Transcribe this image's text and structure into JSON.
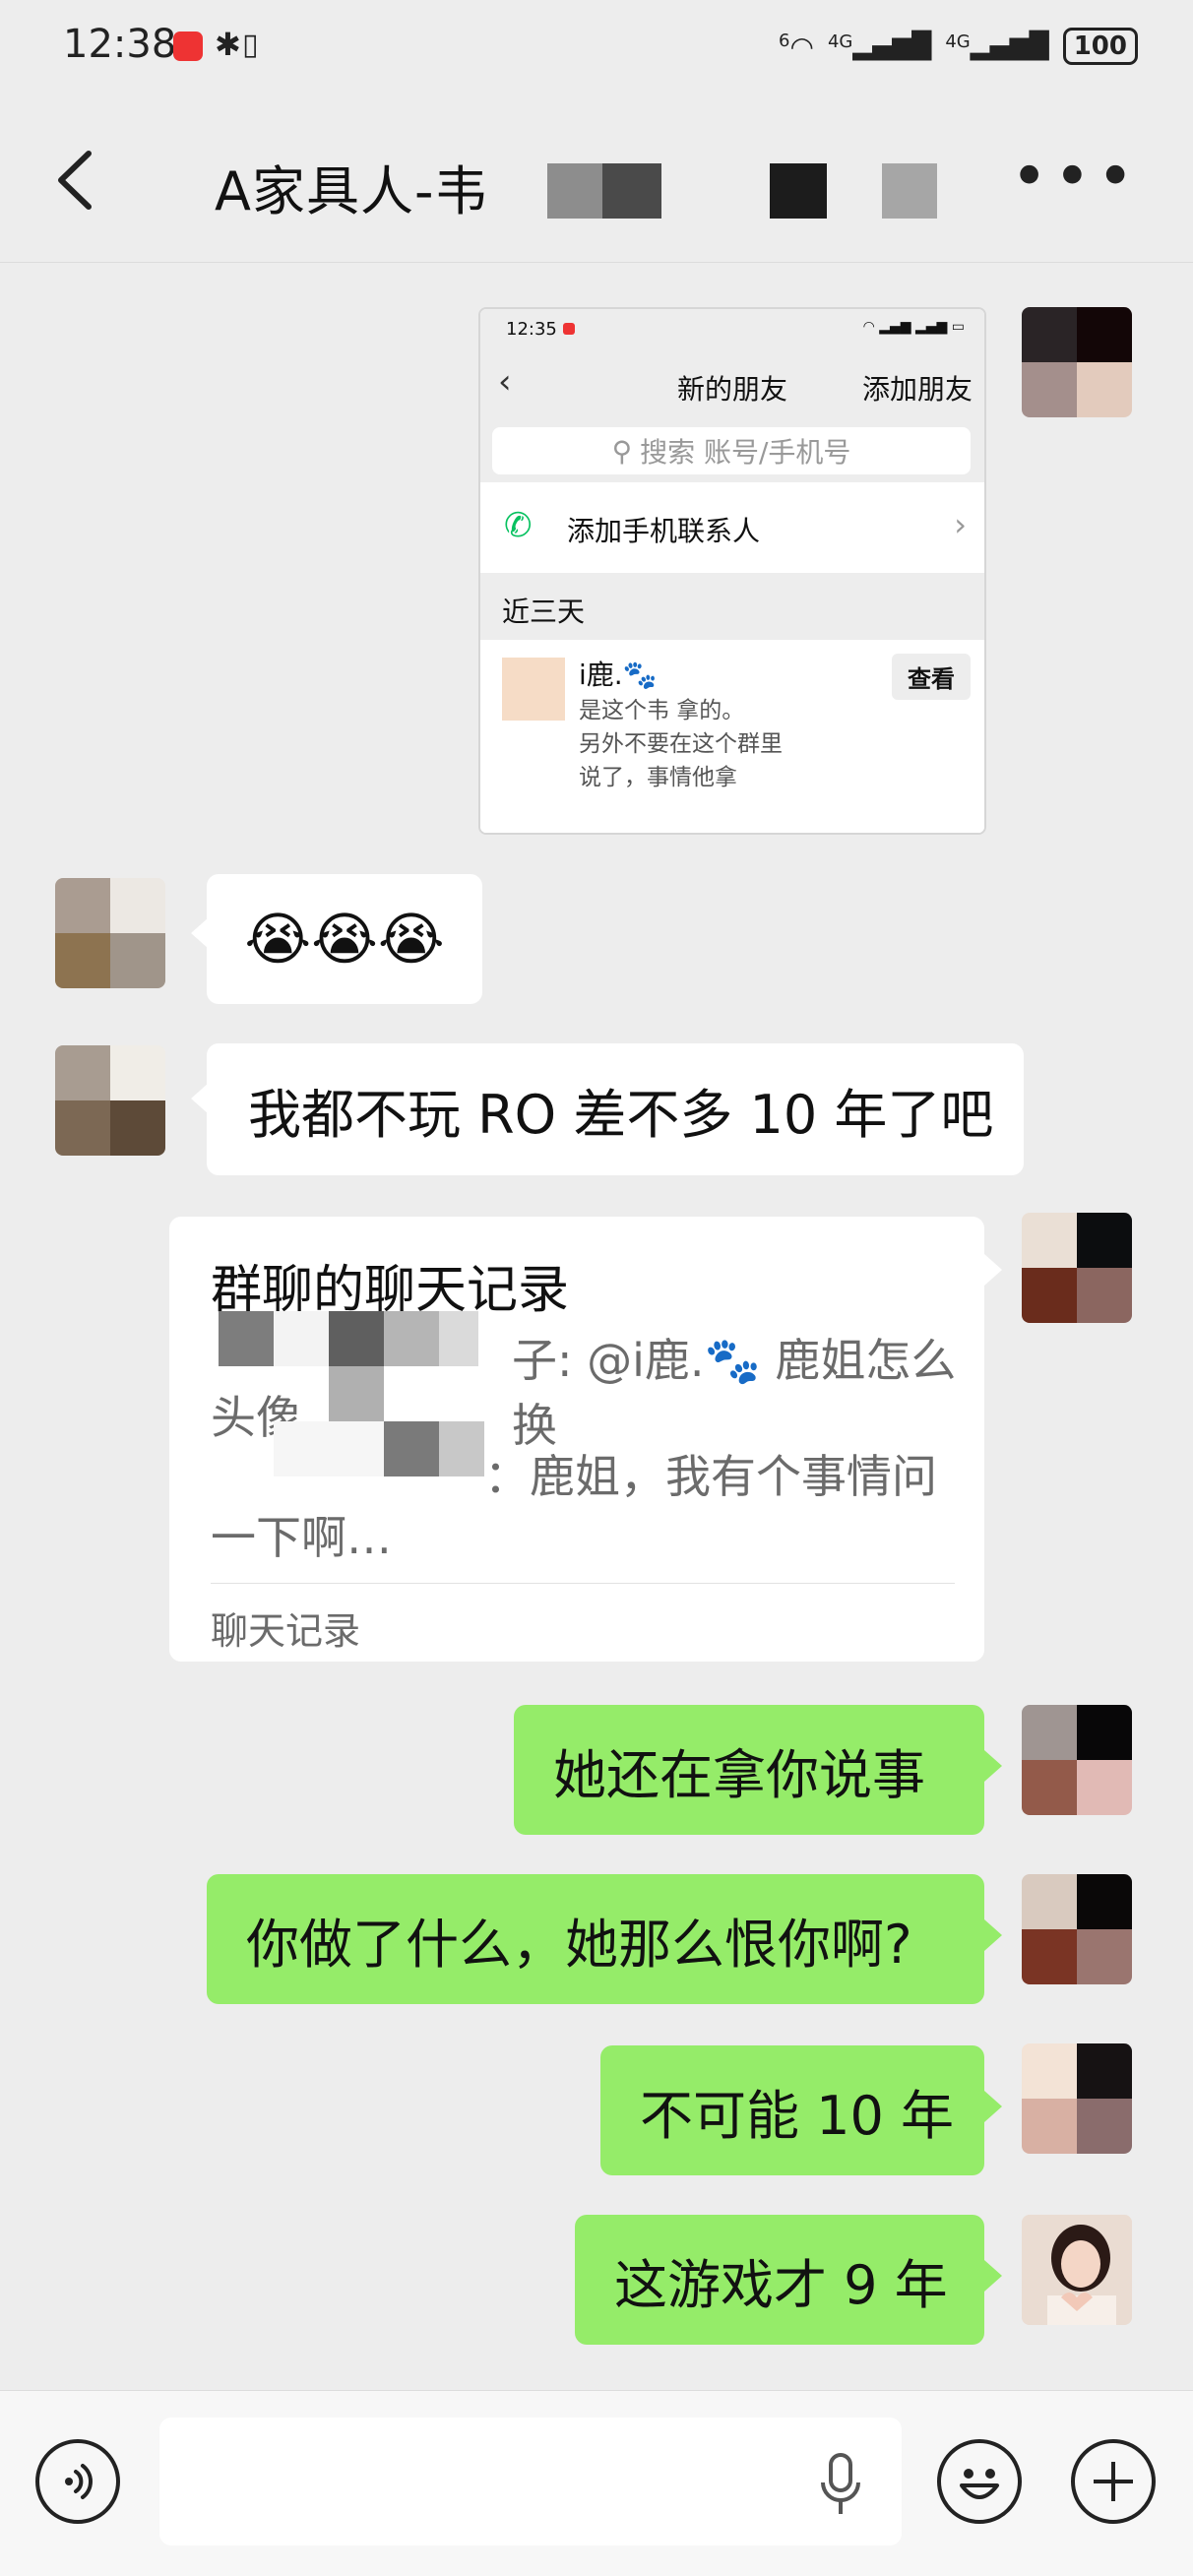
{
  "status_bar": {
    "time": "12:38",
    "network_a": "4G",
    "network_b": "4G",
    "battery": "100",
    "wifi_label": "6"
  },
  "header": {
    "title": "A家具人-韦",
    "back_icon": "chevron-left-icon",
    "more_icon": "more-dots-icon"
  },
  "screenshot_msg": {
    "time": "12:35",
    "nav_title": "新的朋友",
    "nav_action": "添加朋友",
    "search_placeholder": "搜索 账号/手机号",
    "add_contacts": "添加手机联系人",
    "section": "近三天",
    "friend_name": "i鹿.🐾",
    "friend_msg_1": "是这个韦    拿的。",
    "friend_msg_2": "另外不要在这个群里",
    "friend_msg_3": "说了，事情他拿",
    "view_button": "查看"
  },
  "messages": {
    "m1_emoji": "😭😭😭",
    "m2": "我都不玩 RO 差不多 10 年了吧",
    "m4": "她还在拿你说事",
    "m5": "你做了什么，她那么恨你啊?",
    "m6": "不可能 10 年",
    "m7": "这游戏才 9 年"
  },
  "chat_record": {
    "title": "群聊的聊天记录",
    "line1": "子: @i鹿.🐾 鹿姐怎么换",
    "line1b": "头像",
    "line2": "：鹿姐，我有个事情问",
    "line3": "一下啊…",
    "footer": "聊天记录"
  },
  "input_bar": {
    "voice_icon": "voice-icon",
    "mic_icon": "microphone-icon",
    "emoji_icon": "smiley-icon",
    "plus_icon": "plus-icon"
  },
  "colors": {
    "bubble_green": "#95ec69",
    "background": "#ededed",
    "call_green": "#07c160"
  }
}
